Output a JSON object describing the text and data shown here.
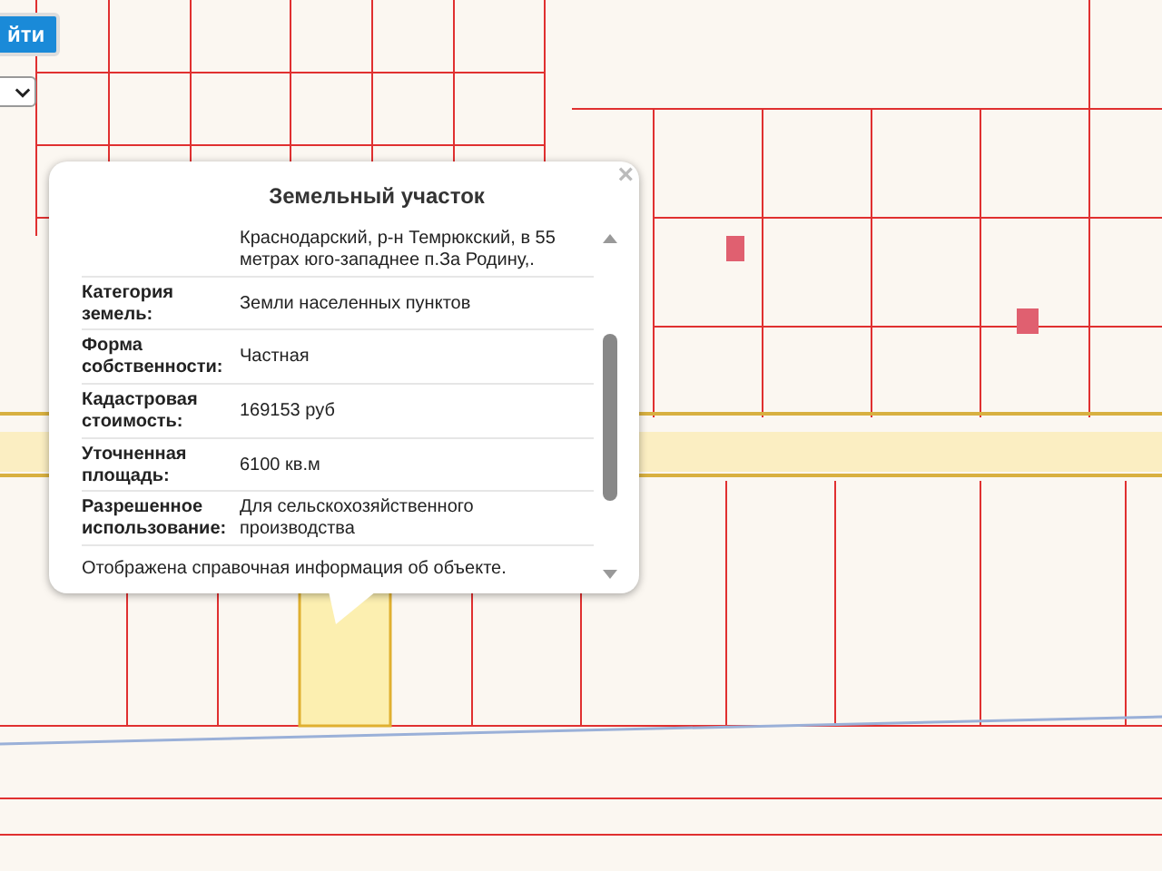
{
  "search_button": {
    "label": "йти"
  },
  "popup": {
    "title": "Земельный участок",
    "close": "×",
    "rows": [
      {
        "value": "Краснодарский, р-н Темрюкский, в 55 метрах юго-западнее п.За Родину,."
      },
      {
        "label": "Категория земель:",
        "value": "Земли населенных пунктов"
      },
      {
        "label": "Форма собственности:",
        "value": "Частная"
      },
      {
        "label": "Кадастровая стоимость:",
        "value": "169153 руб"
      },
      {
        "label": "Уточненная площадь:",
        "value": "6100 кв.м"
      },
      {
        "label": "Разрешенное использование:",
        "value": "Для сельскохозяйственного производства"
      }
    ],
    "footer": "Отображена справочная информация об объекте."
  }
}
